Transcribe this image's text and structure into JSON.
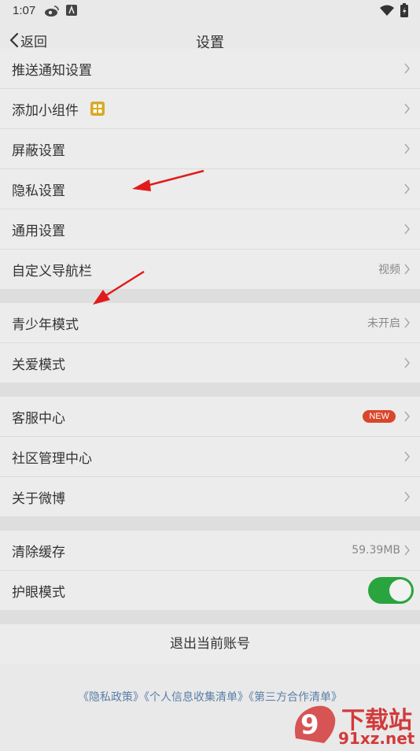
{
  "status_bar": {
    "time": "1:07"
  },
  "header": {
    "back_label": "返回",
    "title": "设置"
  },
  "group1": [
    {
      "label": "推送通知设置"
    },
    {
      "label": "添加小组件"
    },
    {
      "label": "屏蔽设置"
    },
    {
      "label": "隐私设置"
    },
    {
      "label": "通用设置"
    },
    {
      "label": "自定义导航栏",
      "value": "视频"
    }
  ],
  "group2": [
    {
      "label": "青少年模式",
      "value": "未开启"
    },
    {
      "label": "关爱模式"
    }
  ],
  "group3": [
    {
      "label": "客服中心",
      "badge": "NEW"
    },
    {
      "label": "社区管理中心"
    },
    {
      "label": "关于微博"
    }
  ],
  "group4": [
    {
      "label": "清除缓存",
      "value": "59.39MB"
    },
    {
      "label": "护眼模式",
      "toggle_on": true
    }
  ],
  "logout": "退出当前账号",
  "footer_links": [
    "《隐私政策》",
    "《个人信息收集清单》",
    "《第三方合作清单》"
  ],
  "watermark": {
    "cn": "下载站",
    "domain": "91xz.net",
    "digits": "9"
  },
  "colors": {
    "accent": "#2aa43e",
    "link": "#5a7fa8",
    "badge": "#d9472b",
    "annotation": "#e01b1b"
  }
}
